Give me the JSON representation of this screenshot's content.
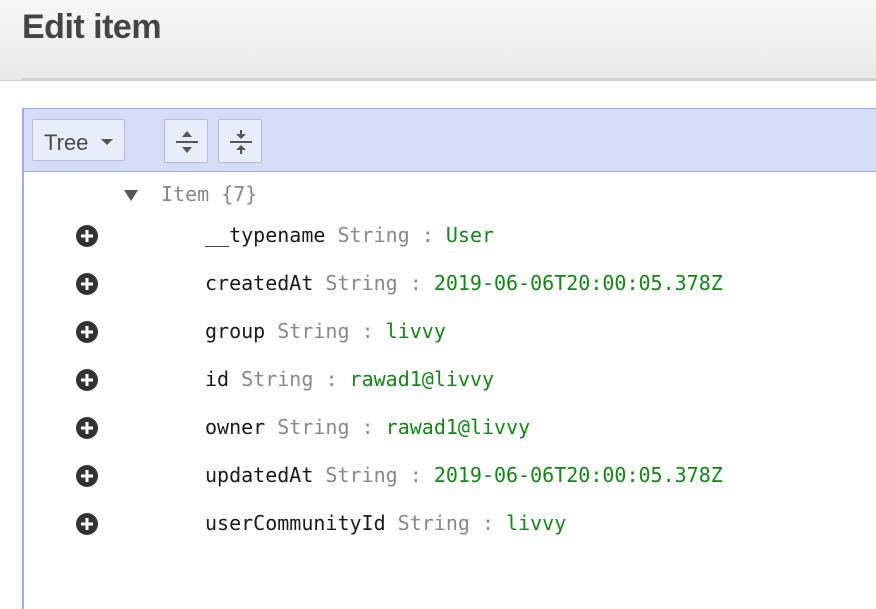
{
  "page": {
    "title": "Edit item"
  },
  "toolbar": {
    "mode_label": "Tree",
    "expand_all_icon": "expand-all-icon",
    "collapse_all_icon": "collapse-all-icon"
  },
  "tree": {
    "root": {
      "label": "Item {7}"
    },
    "fields": [
      {
        "key": "__typename",
        "type": "String",
        "sep": ":",
        "value": "User"
      },
      {
        "key": "createdAt",
        "type": "String",
        "sep": ":",
        "value": "2019-06-06T20:00:05.378Z"
      },
      {
        "key": "group",
        "type": "String",
        "sep": ":",
        "value": "livvy"
      },
      {
        "key": "id",
        "type": "String",
        "sep": ":",
        "value": "rawad1@livvy"
      },
      {
        "key": "owner",
        "type": "String",
        "sep": ":",
        "value": "rawad1@livvy"
      },
      {
        "key": "updatedAt",
        "type": "String",
        "sep": ":",
        "value": "2019-06-06T20:00:05.378Z"
      },
      {
        "key": "userCommunityId",
        "type": "String",
        "sep": ":",
        "value": "livvy"
      }
    ]
  },
  "colors": {
    "value": "#118811",
    "key": "#1a1a1a",
    "type": "#888888",
    "menubar": "#d5ddf6",
    "border": "#97b0e8"
  }
}
